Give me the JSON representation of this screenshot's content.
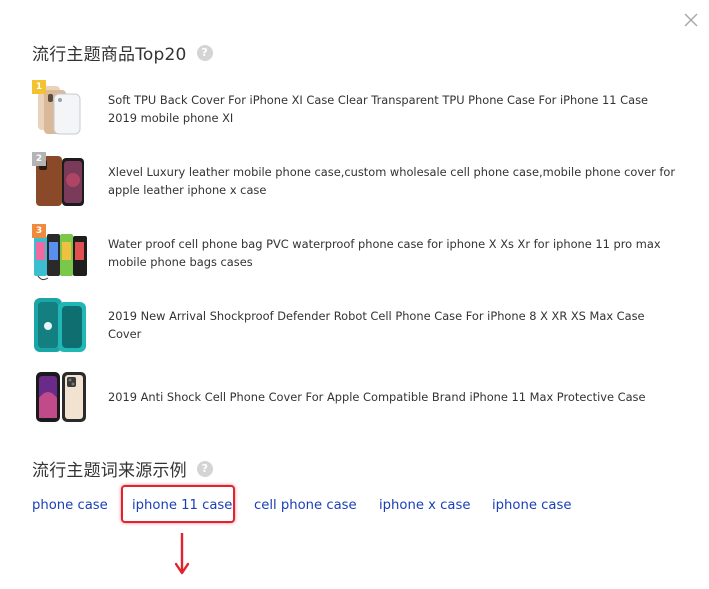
{
  "section1": {
    "title": "流行主题商品Top20",
    "help_icon": "question-circle-icon"
  },
  "products": [
    {
      "rank": "1",
      "badge_color": "#f2c230",
      "title": "Soft TPU Back Cover For iPhone XI Case Clear Transparent TPU Phone Case For iPhone 11 Case 2019 mobile phone XI"
    },
    {
      "rank": "2",
      "badge_color": "#b4b4b4",
      "title": "Xlevel Luxury leather mobile phone case,custom wholesale cell phone case,mobile phone cover for apple leather iphone x case"
    },
    {
      "rank": "3",
      "badge_color": "#f08a3c",
      "title": "Water proof cell phone bag PVC waterproof phone case for iphone X Xs Xr for iphone 11 pro max mobile phone bags cases"
    },
    {
      "rank": "",
      "title": "2019 New Arrival Shockproof Defender Robot Cell Phone Case For iPhone 8 X XR XS Max Case Cover"
    },
    {
      "rank": "",
      "title": "2019 Anti Shock Cell Phone Cover For Apple Compatible Brand iPhone 11 Max Protective Case"
    }
  ],
  "section2": {
    "title": "流行主题词来源示例",
    "help_icon": "question-circle-icon"
  },
  "keywords": [
    "phone case",
    "iphone 11 case",
    "cell phone case",
    "iphone x case",
    "iphone case"
  ],
  "colors": {
    "link": "#1a3fb8",
    "highlight": "#e0242e",
    "text": "#333333"
  }
}
